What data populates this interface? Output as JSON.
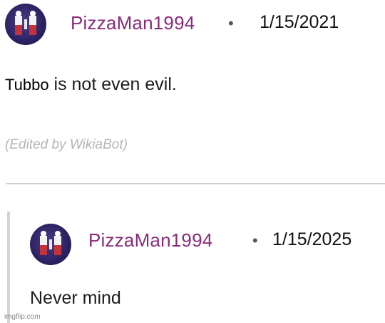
{
  "comment": {
    "username": "PizzaMan1994",
    "separator": "•",
    "date": "1/15/2021",
    "subject": "Tubbo",
    "text": "is not even evil.",
    "edited_note": "(Edited by WikiaBot)"
  },
  "reply": {
    "username": "PizzaMan1994",
    "separator": "•",
    "date": "1/15/2025",
    "text": "Never mind"
  },
  "watermark": "imgflip.com",
  "colors": {
    "username": "#8a2a7c",
    "edited": "#b5b5b5",
    "avatar_bg": "#2b2263"
  }
}
